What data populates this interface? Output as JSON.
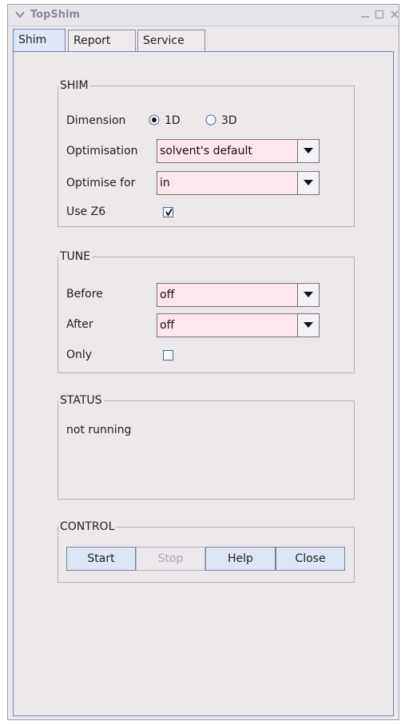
{
  "window": {
    "title": "TopShim"
  },
  "tabs": [
    {
      "label": "Shim",
      "selected": true
    },
    {
      "label": "Report",
      "selected": false
    },
    {
      "label": "Service",
      "selected": false
    }
  ],
  "shim": {
    "title": "SHIM",
    "dimension_label": "Dimension",
    "dimension_options": [
      {
        "label": "1D",
        "selected": true
      },
      {
        "label": "3D",
        "selected": false
      }
    ],
    "optimisation_label": "Optimisation",
    "optimisation_value": "solvent's default",
    "optimise_for_label": "Optimise for",
    "optimise_for_value": "in",
    "use_z6_label": "Use Z6",
    "use_z6_checked": true
  },
  "tune": {
    "title": "TUNE",
    "before_label": "Before",
    "before_value": "off",
    "after_label": "After",
    "after_value": "off",
    "only_label": "Only",
    "only_checked": false
  },
  "status": {
    "title": "STATUS",
    "text": "not running"
  },
  "control": {
    "title": "CONTROL",
    "start_label": "Start",
    "stop_label": "Stop",
    "help_label": "Help",
    "close_label": "Close"
  },
  "colors": {
    "window_bg": "#ece8ec",
    "combo_bg": "#ffe5ec",
    "button_bg": "#dde6f7",
    "active_tab_bg": "#dfe7f8"
  }
}
